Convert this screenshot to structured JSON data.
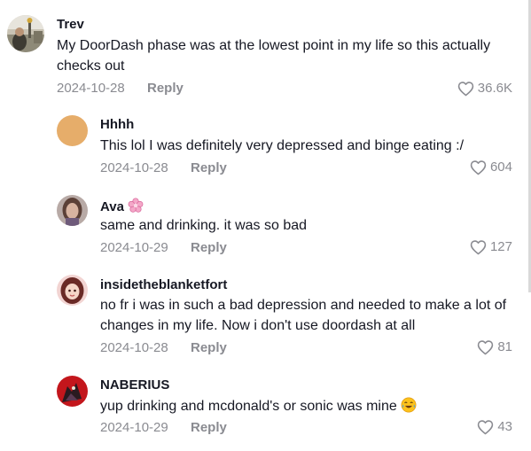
{
  "comments": [
    {
      "username": "Trev",
      "text": "My DoorDash phase was at the lowest point in my life so this actually checks out",
      "date": "2024-10-28",
      "reply_label": "Reply",
      "likes": "36.6K",
      "avatar": "person-outdoor-photo"
    },
    {
      "username": "Hhhh",
      "text": "This lol I was definitely very depressed and binge eating :/",
      "date": "2024-10-28",
      "reply_label": "Reply",
      "likes": "604",
      "avatar": "tan-solid"
    },
    {
      "username": "Ava",
      "badge": "cherry-blossom-emoji",
      "text": "same and drinking. it was so bad",
      "date": "2024-10-29",
      "reply_label": "Reply",
      "likes": "127",
      "avatar": "selfie-photo"
    },
    {
      "username": "insidetheblanketfort",
      "text": "no fr i was in such a bad depression and needed to make a lot of changes in my life. Now i don't use doordash at all",
      "date": "2024-10-28",
      "reply_label": "Reply",
      "likes": "81",
      "avatar": "drawn-girl-portrait"
    },
    {
      "username": "NABERIUS",
      "text": "yup drinking and mcdonald's or sonic was mine",
      "emoji": "tears-of-joy-emoji",
      "date": "2024-10-29",
      "reply_label": "Reply",
      "likes": "43",
      "avatar": "dark-red-character"
    }
  ],
  "colors": {
    "text": "#161823",
    "muted": "#8a8b91"
  }
}
